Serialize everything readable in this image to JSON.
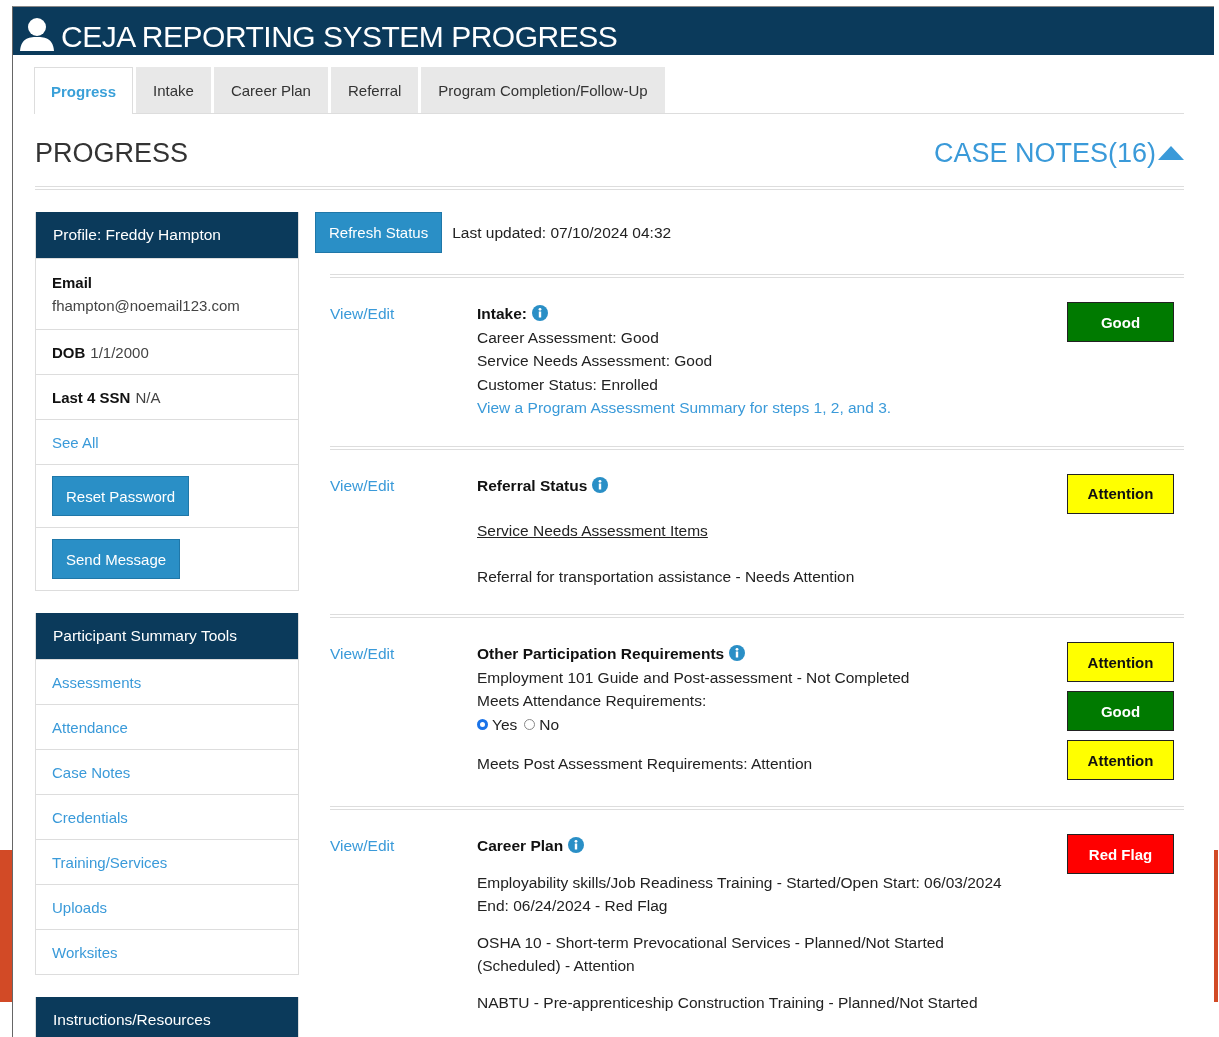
{
  "header": {
    "title": "CEJA REPORTING SYSTEM PROGRESS"
  },
  "tabs": [
    {
      "label": "Progress",
      "selected": true
    },
    {
      "label": "Intake",
      "selected": false
    },
    {
      "label": "Career Plan",
      "selected": false
    },
    {
      "label": "Referral",
      "selected": false
    },
    {
      "label": "Program Completion/Follow-Up",
      "selected": false
    }
  ],
  "page_title": "PROGRESS",
  "case_notes": {
    "label": "CASE NOTES(16)",
    "expanded": true
  },
  "profile": {
    "title": "Profile: Freddy Hampton",
    "fields": [
      {
        "label": "Email",
        "value": "fhampton@noemail123.com",
        "kind": "stacked"
      },
      {
        "label": "DOB",
        "value": "1/1/2000",
        "kind": "inline"
      },
      {
        "label": "Last 4 SSN",
        "value": "N/A",
        "kind": "inline"
      }
    ],
    "see_all": "See All",
    "buttons": [
      "Reset Password",
      "Send Message"
    ]
  },
  "tools": {
    "title": "Participant Summary Tools",
    "items": [
      "Assessments",
      "Attendance",
      "Case Notes",
      "Credentials",
      "Training/Services",
      "Uploads",
      "Worksites"
    ]
  },
  "resources": {
    "title": "Instructions/Resources"
  },
  "refresh": {
    "button": "Refresh Status",
    "last_updated": "Last updated: 07/10/2024 04:32"
  },
  "sections": [
    {
      "link": "View/Edit",
      "paragraphs": [
        [
          {
            "kind": "heading",
            "text": "Intake:"
          },
          {
            "kind": "text",
            "text": "Career Assessment: Good"
          },
          {
            "kind": "text",
            "text": "Service Needs Assessment: Good"
          },
          {
            "kind": "text",
            "text": "Customer Status: Enrolled"
          },
          {
            "kind": "link",
            "text": "View a Program Assessment Summary for steps 1, 2, and 3."
          }
        ]
      ],
      "badges": [
        {
          "label": "Good",
          "color": "#007a00"
        }
      ]
    },
    {
      "link": "View/Edit",
      "paragraphs": [
        [
          {
            "kind": "heading",
            "text": "Referral Status"
          }
        ],
        [
          {
            "kind": "underline",
            "text": "Service Needs Assessment Items"
          }
        ],
        [
          {
            "kind": "text",
            "text": "Referral for transportation assistance - Needs Attention"
          }
        ]
      ],
      "badges": [
        {
          "label": "Attention",
          "color": "#ffff00"
        }
      ]
    },
    {
      "link": "View/Edit",
      "paragraphs": [
        [
          {
            "kind": "heading",
            "text": "Other Participation Requirements"
          },
          {
            "kind": "text",
            "text": "Employment 101 Guide and Post-assessment - Not Completed"
          },
          {
            "kind": "text",
            "text": "Meets Attendance Requirements:"
          },
          {
            "kind": "radio",
            "options": [
              {
                "label": "Yes",
                "selected": true
              },
              {
                "label": "No",
                "selected": false
              }
            ]
          }
        ],
        [
          {
            "kind": "text",
            "text": "Meets Post Assessment Requirements: Attention"
          }
        ]
      ],
      "badges": [
        {
          "label": "Attention",
          "color": "#ffff00"
        },
        {
          "label": "Good",
          "color": "#007a00"
        },
        {
          "label": "Attention",
          "color": "#ffff00"
        }
      ]
    },
    {
      "link": "View/Edit",
      "paragraphs": [
        [
          {
            "kind": "heading",
            "text": "Career Plan"
          }
        ],
        [
          {
            "kind": "text",
            "text": "Employability skills/Job Readiness Training - Started/Open Start: 06/03/2024 End: 06/24/2024 - Red Flag"
          }
        ],
        [
          {
            "kind": "text",
            "text": "OSHA 10 - Short-term Prevocational Services - Planned/Not Started (Scheduled) - Attention"
          }
        ],
        [
          {
            "kind": "text",
            "text": "NABTU - Pre-apprenticeship Construction Training - Planned/Not Started"
          }
        ]
      ],
      "badges": [
        {
          "label": "Red Flag",
          "color": "#ff0000"
        }
      ]
    }
  ]
}
